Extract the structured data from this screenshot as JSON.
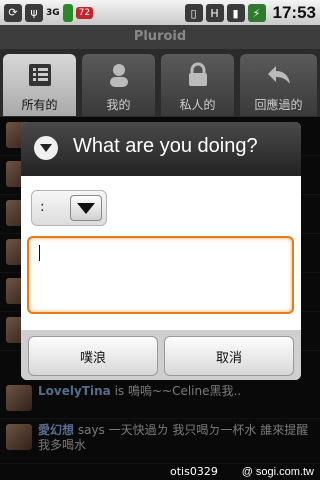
{
  "status_bar": {
    "time": "17:53",
    "network_label": "3G",
    "battery_badge": "72",
    "icons": [
      "sync-icon",
      "usb-icon",
      "battery-icon",
      "vibrate-icon",
      "h-data-icon",
      "signal-icon",
      "charging-icon"
    ]
  },
  "app": {
    "title": "Pluroid"
  },
  "tabs": [
    {
      "label": "所有的",
      "icon": "list-icon",
      "active": true
    },
    {
      "label": "我的",
      "icon": "person-icon",
      "active": false
    },
    {
      "label": "私人的",
      "icon": "lock-icon",
      "active": false
    },
    {
      "label": "回應過的",
      "icon": "reply-icon",
      "active": false
    }
  ],
  "feed": [
    {
      "user": "LovelyTina",
      "text": "is 鳴嗚~~Celine黑我.."
    },
    {
      "user": "愛幻想",
      "text": "says 一天快過ㄌ 我只喝ㄉ一杯水 誰來提醒我多喝水"
    }
  ],
  "dialog": {
    "title": "What are you doing?",
    "qualifier_value": ":",
    "input_value": "",
    "submit_label": "噗浪",
    "cancel_label": "取消"
  },
  "watermark": {
    "user": "otis0329",
    "site": "@ sogi.com.tw"
  },
  "colors": {
    "focus": "#e57a1b",
    "tab_active": "#c8c8c8"
  }
}
